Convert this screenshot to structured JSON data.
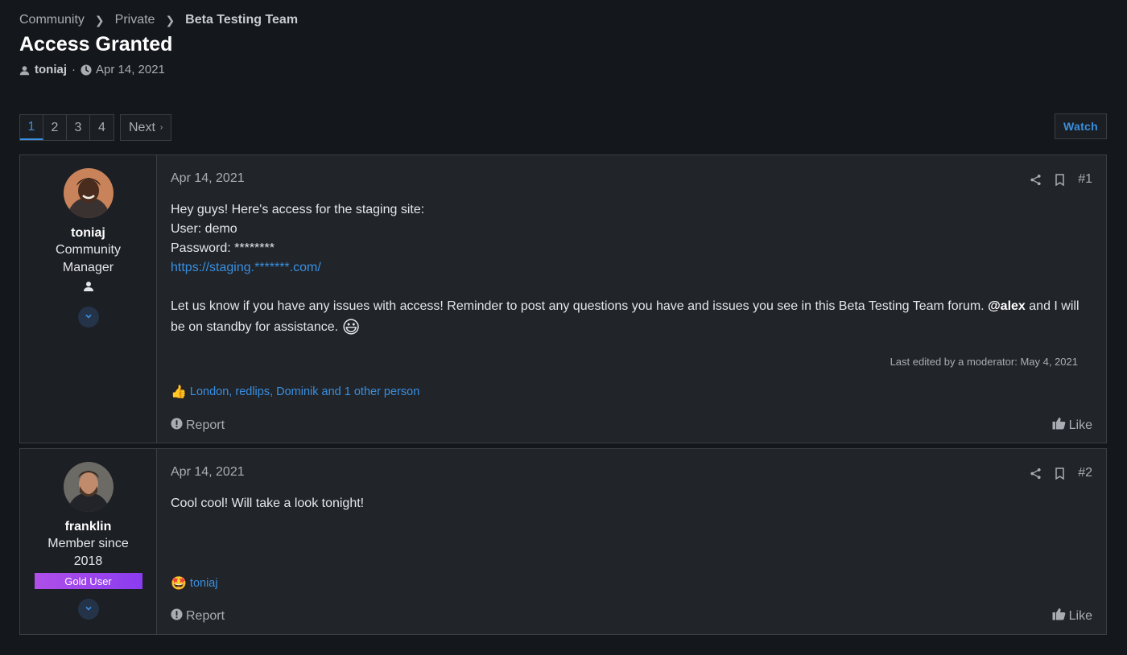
{
  "breadcrumb": [
    "Community",
    "Private",
    "Beta Testing Team"
  ],
  "thread": {
    "title": "Access Granted",
    "author": "toniaj",
    "date": "Apr 14, 2021"
  },
  "pagination": {
    "pages": [
      "1",
      "2",
      "3",
      "4"
    ],
    "current": "1",
    "next_label": "Next"
  },
  "watch_label": "Watch",
  "posts": [
    {
      "username": "toniaj",
      "title": "Community Manager",
      "date": "Apr 14, 2021",
      "number": "#1",
      "lines": [
        "Hey guys! Here's access for the staging site:",
        "User: demo",
        "Password: ********"
      ],
      "link": "https://staging.*******.com/",
      "para2_before": "Let us know if you have any issues with access! Reminder to post any questions you have and issues you see in this Beta Testing Team forum. ",
      "mention": "@alex",
      "para2_after": " and I will be on standby for assistance.",
      "emoji": "😃",
      "edited": "Last edited by a moderator: May 4, 2021",
      "reactions": "London, redlips, Dominik and 1 other person",
      "reaction_emoji": "👍",
      "report_label": "Report",
      "like_label": "Like"
    },
    {
      "username": "franklin",
      "title": "Member since 2018",
      "badge": "Gold User",
      "date": "Apr 14, 2021",
      "number": "#2",
      "body": "Cool cool! Will take a look tonight!",
      "reactions": "toniaj",
      "reaction_emoji": "🤩",
      "report_label": "Report",
      "like_label": "Like"
    }
  ],
  "colors": {
    "accent": "#3a8fe0",
    "background": "#14171b",
    "post_bg": "#212429",
    "gold_badge_start": "#b04fe8",
    "gold_badge_end": "#8a3cf0"
  }
}
